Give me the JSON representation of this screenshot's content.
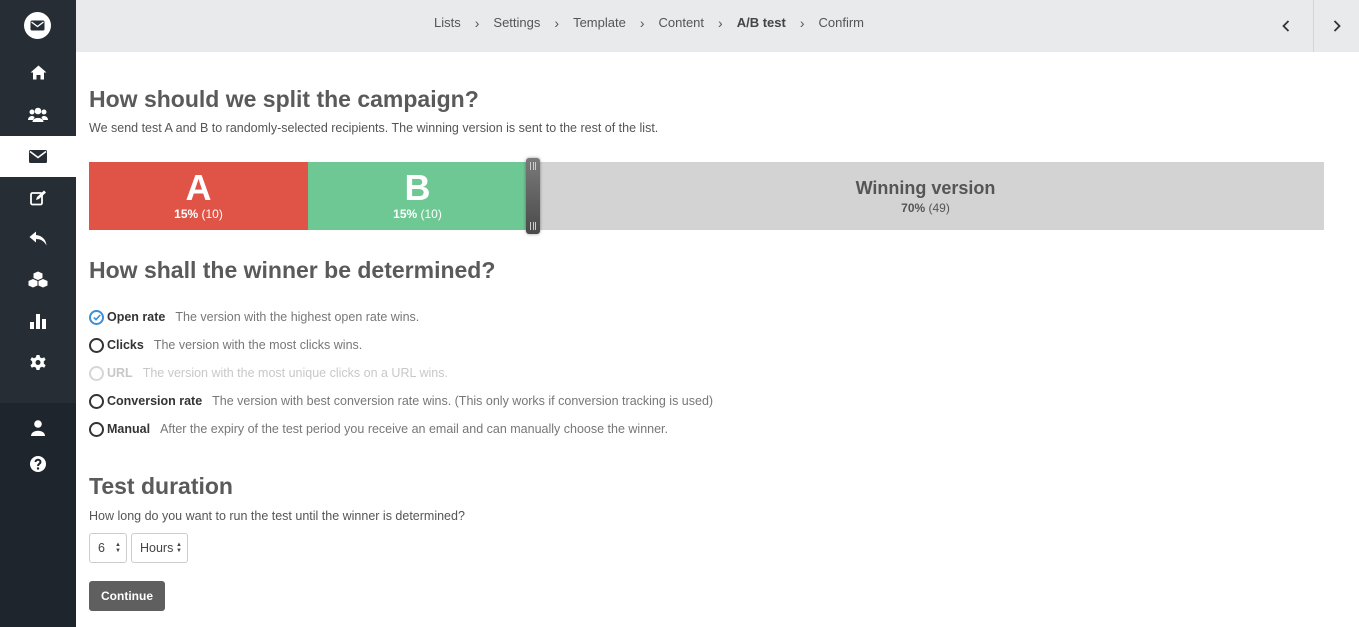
{
  "breadcrumb": [
    "Lists",
    "Settings",
    "Template",
    "Content",
    "A/B test",
    "Confirm"
  ],
  "breadcrumb_active": "A/B test",
  "sidebar": {
    "icons": [
      "envelope-logo-icon",
      "home-icon",
      "users-icon",
      "envelope-icon",
      "edit-icon",
      "reply-icon",
      "cubes-icon",
      "bar-chart-icon",
      "gear-icon",
      "user-icon",
      "help-icon"
    ],
    "active": "envelope-icon"
  },
  "split": {
    "heading": "How should we split the campaign?",
    "description": "We send test A and B to randomly-selected recipients. The winning version is sent to the rest of the list.",
    "a": {
      "letter": "A",
      "pct": "15%",
      "count": "(10)",
      "color": "#e05447"
    },
    "b": {
      "letter": "B",
      "pct": "15%",
      "count": "(10)",
      "color": "#6ec894"
    },
    "winner": {
      "title": "Winning version",
      "pct": "70%",
      "count": "(49)",
      "color": "#d3d3d3"
    }
  },
  "winner": {
    "heading": "How shall the winner be determined?",
    "options": [
      {
        "label": "Open rate",
        "hint": "The version with the highest open rate wins.",
        "checked": true,
        "disabled": false
      },
      {
        "label": "Clicks",
        "hint": "The version with the most clicks wins.",
        "checked": false,
        "disabled": false
      },
      {
        "label": "URL",
        "hint": "The version with the most unique clicks on a URL wins.",
        "checked": false,
        "disabled": true
      },
      {
        "label": "Conversion rate",
        "hint": "The version with best conversion rate wins. (This only works if conversion tracking is used)",
        "checked": false,
        "disabled": false
      },
      {
        "label": "Manual",
        "hint": "After the expiry of the test period you receive an email and can manually choose the winner.",
        "checked": false,
        "disabled": false
      }
    ]
  },
  "duration": {
    "heading": "Test duration",
    "question": "How long do you want to run the test until the winner is determined?",
    "value": "6",
    "unit": "Hours"
  },
  "continue_label": "Continue"
}
